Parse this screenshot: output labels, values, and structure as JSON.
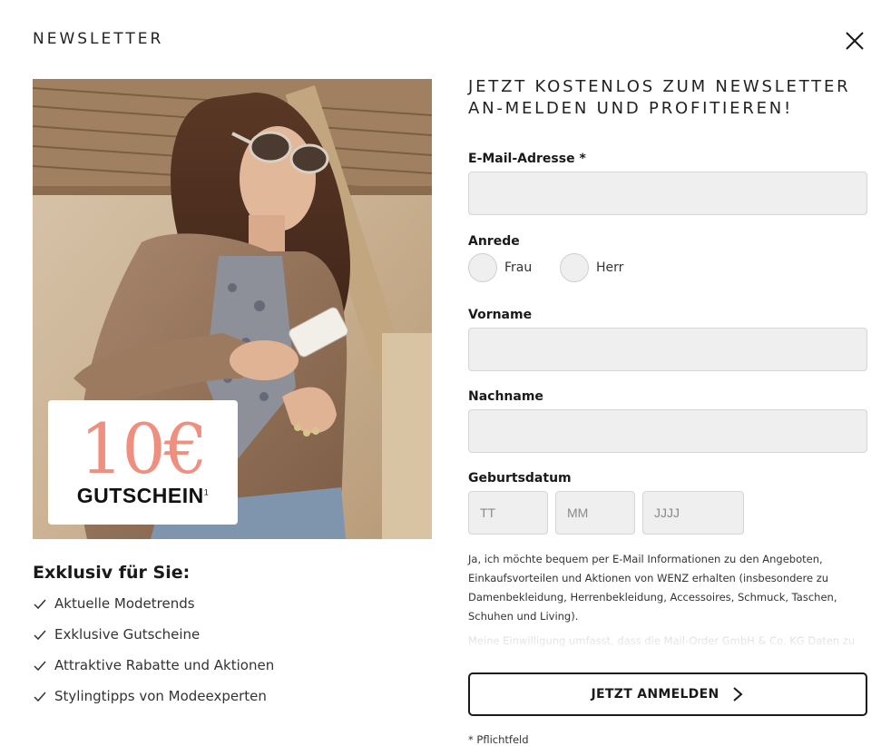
{
  "header": {
    "title": "NEWSLETTER",
    "close_icon": "close-icon"
  },
  "hero": {
    "voucher_amount": "10€",
    "voucher_label": "GUTSCHEIN",
    "voucher_footnote": "1",
    "voucher_color": "#ef8f7f"
  },
  "benefits": {
    "heading": "Exklusiv für Sie:",
    "icon": "checkmark-icon",
    "items": [
      "Aktuelle Modetrends",
      "Exklusive Gutscheine",
      "Attraktive Rabatte und Aktionen",
      "Stylingtipps von Modeexperten"
    ]
  },
  "form": {
    "heading": "JETZT KOSTENLOS ZUM NEWSLETTER AN-MELDEN UND PROFITIEREN!",
    "email_label": "E-Mail-Adresse *",
    "email_value": "",
    "salutation_label": "Anrede",
    "salutation_options": [
      "Frau",
      "Herr"
    ],
    "firstname_label": "Vorname",
    "firstname_value": "",
    "lastname_label": "Nachname",
    "lastname_value": "",
    "birthdate_label": "Geburtsdatum",
    "birthdate_placeholders": {
      "day": "TT",
      "month": "MM",
      "year": "JJJJ"
    },
    "consent_text": "Ja, ich möchte bequem per E-Mail Informationen zu den Angeboten, Einkaufsvorteilen und Aktionen von WENZ erhalten (insbesondere zu Damenbekleidung, Herrenbekleidung, Accessoires, Schmuck, Taschen, Schuhen und Living).",
    "consent_fade_text": "Meine Einwilligung umfasst, dass die Mail-Order GmbH & Co. KG Daten zu ihren",
    "submit_label": "JETZT ANMELDEN",
    "required_note": "* Pflichtfeld"
  }
}
